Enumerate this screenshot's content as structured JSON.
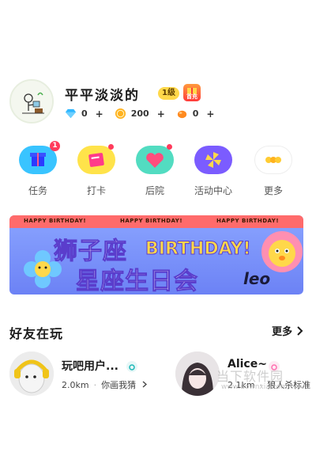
{
  "profile": {
    "username": "平平淡淡的",
    "level": "1级",
    "recharge_label": "首充",
    "currencies": [
      {
        "icon": "diamond-icon",
        "value": "0",
        "color": "#2fb7ff"
      },
      {
        "icon": "coin-icon",
        "value": "200",
        "color": "#ffb21f"
      },
      {
        "icon": "bean-icon",
        "value": "0",
        "color": "#ff8a1f"
      }
    ],
    "plus": "+"
  },
  "actions": [
    {
      "label": "任务",
      "icon": "gift-icon",
      "badge": "1",
      "color": "#39c4ff"
    },
    {
      "label": "打卡",
      "icon": "checkin-icon",
      "color": "#ffe34a"
    },
    {
      "label": "后院",
      "icon": "heart-icon",
      "color": "#52dcc1"
    },
    {
      "label": "活动中心",
      "icon": "pinwheel-icon",
      "color": "#7b5cff"
    },
    {
      "label": "更多",
      "icon": "more-icon",
      "color": "#ffcc33"
    }
  ],
  "banner": {
    "header_text": "HAPPY BIRTHDAY!",
    "title_line1": "狮子座",
    "title_en": "BIRTHDAY!",
    "title_line2": "星座生日会",
    "leo": "leo"
  },
  "friends_section": {
    "title": "好友在玩",
    "more_label": "更多",
    "friends": [
      {
        "name": "玩吧用户...",
        "distance": "2.0km",
        "game": "你画我猜",
        "tag_color": "#1db8b8"
      },
      {
        "name": "Alice~",
        "distance": "2.1km",
        "game": "狼人杀标准",
        "tag_color": "#ff6fb0"
      }
    ]
  },
  "watermark": {
    "text": "当下软件园",
    "url": "www.downxia.com"
  }
}
